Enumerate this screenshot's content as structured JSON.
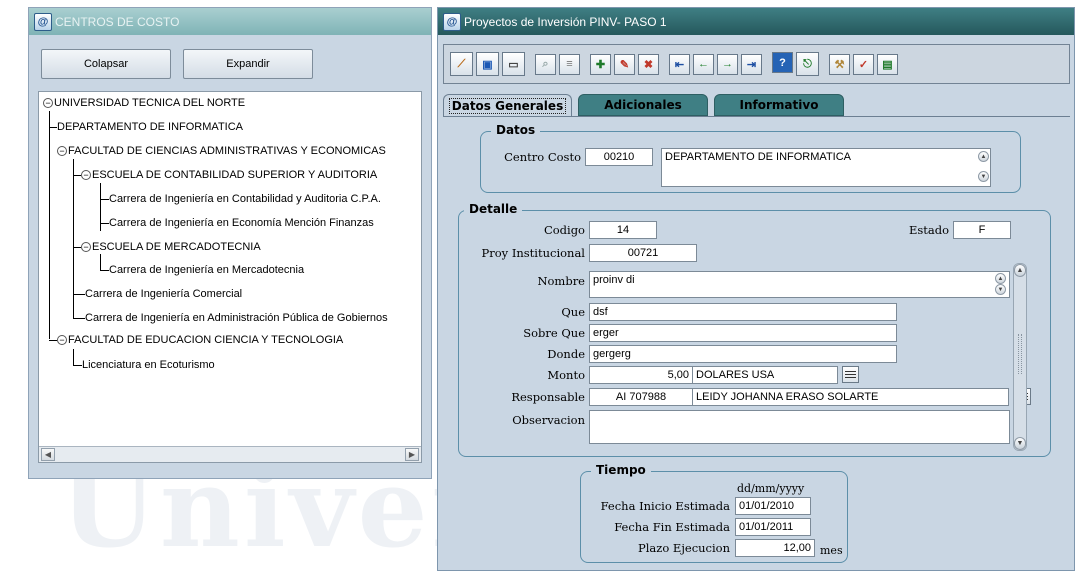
{
  "left_window": {
    "title": "CENTROS DE COSTO",
    "icon": "app-icon",
    "collapse_label": "Colapsar",
    "expand_label": "Expandir",
    "tree": [
      {
        "label": "UNIVERSIDAD TECNICA DEL NORTE",
        "toggle": "−"
      },
      {
        "label": "DEPARTAMENTO DE INFORMATICA"
      },
      {
        "label": "FACULTAD DE CIENCIAS ADMINISTRATIVAS Y ECONOMICAS",
        "toggle": "−"
      },
      {
        "label": "ESCUELA DE CONTABILIDAD SUPERIOR Y AUDITORIA",
        "toggle": "−"
      },
      {
        "label": "Carrera de Ingeniería en Contabilidad y Auditoria C.P.A."
      },
      {
        "label": "Carrera de Ingeniería en Economía Mención Finanzas"
      },
      {
        "label": "ESCUELA DE MERCADOTECNIA",
        "toggle": "−"
      },
      {
        "label": "Carrera de Ingeniería en Mercadotecnia"
      },
      {
        "label": "Carrera de Ingeniería Comercial"
      },
      {
        "label": "Carrera de Ingeniería en Administración Pública de Gobiernos"
      },
      {
        "label": "FACULTAD DE EDUCACION CIENCIA Y TECNOLOGIA",
        "toggle": "−"
      },
      {
        "label": "Licenciatura en Ecoturismo"
      }
    ]
  },
  "right_window": {
    "title": "Proyectos de Inversión PINV- PASO 1",
    "tabs": [
      {
        "label": "Datos Generales",
        "active": true
      },
      {
        "label": "Adicionales",
        "active": false
      },
      {
        "label": "Informativo",
        "active": false
      }
    ],
    "datos": {
      "legend": "Datos",
      "centro_costo_label": "Centro Costo",
      "centro_costo_code": "00210",
      "centro_costo_name": "DEPARTAMENTO DE INFORMATICA"
    },
    "detalle": {
      "legend": "Detalle",
      "codigo_label": "Codigo",
      "codigo": "14",
      "estado_label": "Estado",
      "estado": "F",
      "proy_inst_label": "Proy Institucional",
      "proy_inst": "00721",
      "nombre_label": "Nombre",
      "nombre": "proinv di",
      "que_label": "Que",
      "que": "dsf",
      "sobre_que_label": "Sobre Que",
      "sobre_que": "erger",
      "donde_label": "Donde",
      "donde": "gergerg",
      "monto_label": "Monto",
      "monto": "5,00",
      "moneda": "DOLARES USA",
      "responsable_label": "Responsable",
      "responsable_id": "AI 707988",
      "responsable_name": "LEIDY JOHANNA ERASO SOLARTE",
      "observacion_label": "Observacion",
      "observacion": ""
    },
    "tiempo": {
      "legend": "Tiempo",
      "date_format": "dd/mm/yyyy",
      "inicio_label": "Fecha Inicio Estimada",
      "inicio": "01/01/2010",
      "fin_label": "Fecha Fin Estimada",
      "fin": "01/01/2011",
      "plazo_label": "Plazo Ejecucion",
      "plazo": "12,00",
      "plazo_unit": "mes"
    }
  },
  "watermark": "Universidad"
}
